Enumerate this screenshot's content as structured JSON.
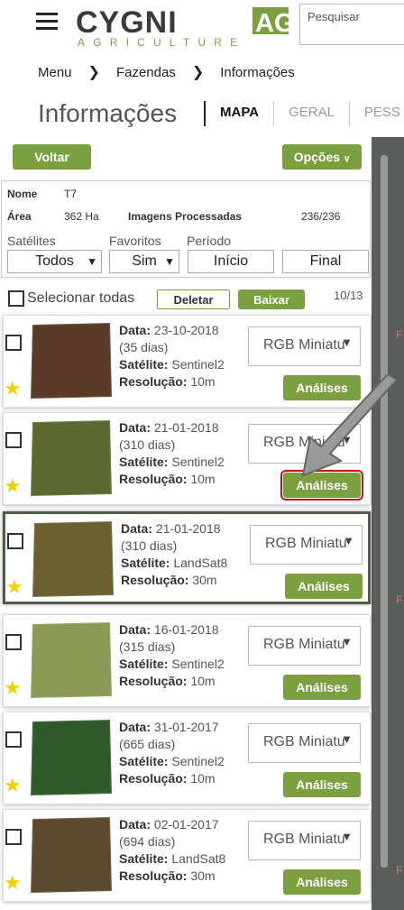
{
  "header": {
    "brand_main": "CYGNI",
    "brand_ag": "AG",
    "brand_sub": "AGRICULTURE",
    "search_placeholder": "Pesquisar"
  },
  "breadcrumb": [
    "Menu",
    "Fazendas",
    "Informações"
  ],
  "page_title": "Informações",
  "tabs": [
    "MAPA",
    "GERAL",
    "PESS"
  ],
  "buttons": {
    "voltar": "Voltar",
    "opcoes": "Opções",
    "deletar": "Deletar",
    "baixar": "Baixar",
    "analises": "Análises"
  },
  "farm": {
    "nome_label": "Nome",
    "nome": "T7",
    "area_label": "Área",
    "area": "362 Ha",
    "imagens_label": "Imagens Processadas",
    "imagens": "236/236"
  },
  "filters": {
    "satelites_label": "Satélites",
    "satelites_value": "Todos",
    "favoritos_label": "Favoritos",
    "favoritos_value": "Sim",
    "periodo_label": "Período",
    "inicio": "Início",
    "final": "Final"
  },
  "select_all_label": "Selecionar todas",
  "count": "10/13",
  "side_letter": "F",
  "labels": {
    "data": "Data:",
    "satelite": "Satélite:",
    "resolucao": "Resolução:"
  },
  "cards": [
    {
      "date": "23-10-2018",
      "days": "(35 dias)",
      "satellite": "Sentinel2",
      "resolution": "10m",
      "view": "RGB Miniatu",
      "color": "#5a3a28"
    },
    {
      "date": "21-01-2018",
      "days": "(310 dias)",
      "satellite": "Sentinel2",
      "resolution": "10m",
      "view": "RGB Miniatu",
      "color": "#5a6a30"
    },
    {
      "date": "21-01-2018",
      "days": "(310 dias)",
      "satellite": "LandSat8",
      "resolution": "30m",
      "view": "RGB Miniatu",
      "color": "#6a6030"
    },
    {
      "date": "16-01-2018",
      "days": "(315 dias)",
      "satellite": "Sentinel2",
      "resolution": "10m",
      "view": "RGB Miniatu",
      "color": "#8a9a55"
    },
    {
      "date": "31-01-2017",
      "days": "(665 dias)",
      "satellite": "Sentinel2",
      "resolution": "10m",
      "view": "RGB Miniatu",
      "color": "#2e5a2a"
    },
    {
      "date": "02-01-2017",
      "days": "(694 dias)",
      "satellite": "LandSat8",
      "resolution": "30m",
      "view": "RGB Miniatu",
      "color": "#5a4a30"
    }
  ],
  "colors": {
    "accent": "#7ca040",
    "highlight": "#c0141a",
    "star": "#f0d000"
  }
}
